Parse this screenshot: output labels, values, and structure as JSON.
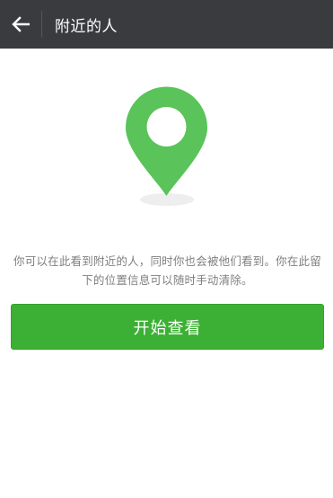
{
  "header": {
    "title": "附近的人",
    "back_icon": "back-arrow-icon"
  },
  "main": {
    "illustration_icon": "location-pin-icon",
    "pin_color": "#5ac35a",
    "description": "你可以在此看到附近的人，同时你也会被他们看到。你在此留下的位置信息可以随时手动清除。",
    "start_button_label": "开始查看",
    "button_color": "#3cb034"
  }
}
